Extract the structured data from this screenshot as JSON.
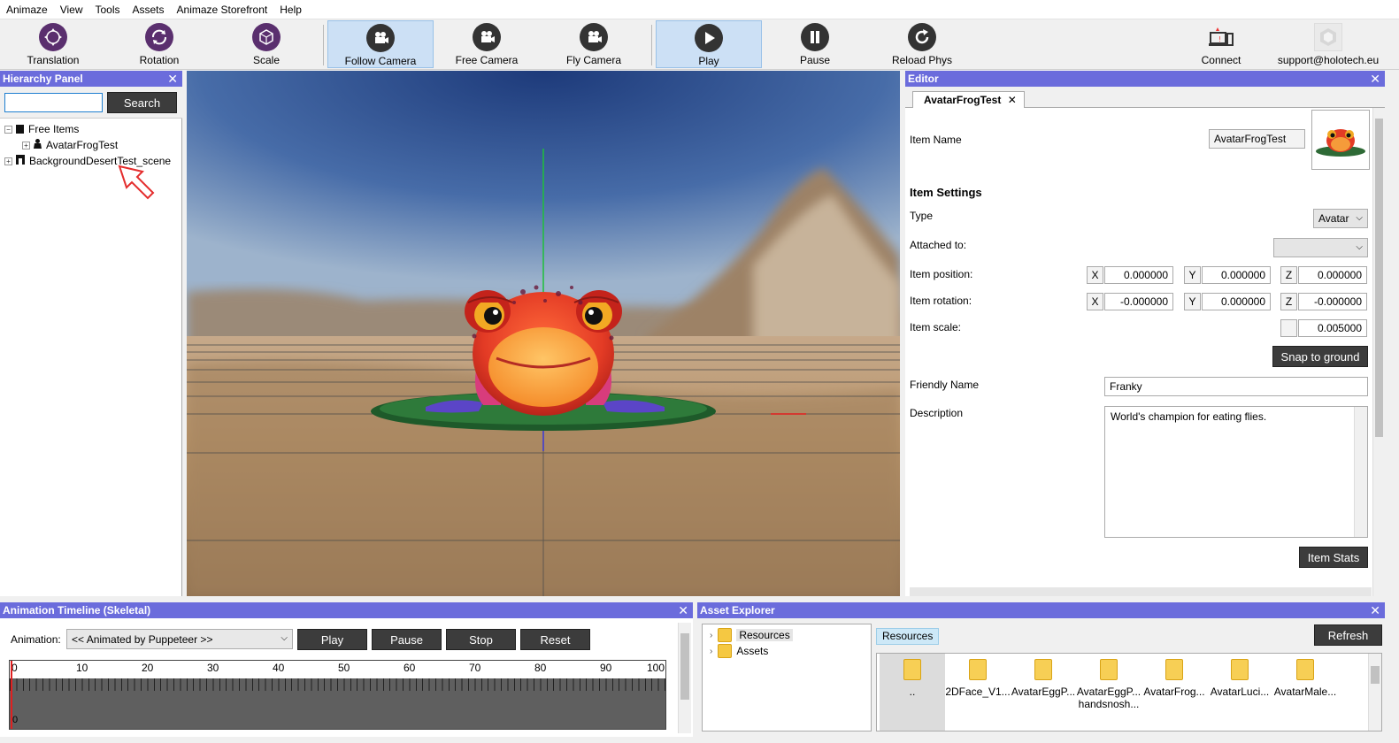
{
  "menu": [
    "Animaze",
    "View",
    "Tools",
    "Assets",
    "Animaze Storefront",
    "Help"
  ],
  "toolbar": {
    "translation": "Translation",
    "rotation": "Rotation",
    "scale": "Scale",
    "follow_camera": "Follow Camera",
    "free_camera": "Free Camera",
    "fly_camera": "Fly Camera",
    "play": "Play",
    "pause": "Pause",
    "reload_phys": "Reload Phys",
    "connect": "Connect",
    "support": "support@holotech.eu"
  },
  "hierarchy": {
    "title": "Hierarchy Panel",
    "search_value": "",
    "search_button": "Search",
    "items": [
      {
        "label": "Free Items"
      },
      {
        "label": "AvatarFrogTest"
      },
      {
        "label": "BackgroundDesertTest_scene"
      }
    ]
  },
  "editor": {
    "title": "Editor",
    "tab": "AvatarFrogTest",
    "item_name_label": "Item Name",
    "item_name_value": "AvatarFrogTest",
    "item_settings": "Item Settings",
    "type_label": "Type",
    "type_value": "Avatar",
    "attached_label": "Attached to:",
    "attached_value": "",
    "position_label": "Item position:",
    "position": {
      "x": "0.000000",
      "y": "0.000000",
      "z": "0.000000"
    },
    "rotation_label": "Item rotation:",
    "rotation": {
      "x": "-0.000000",
      "y": "0.000000",
      "z": "-0.000000"
    },
    "scale_label": "Item scale:",
    "scale_value": "0.005000",
    "snap_button": "Snap to ground",
    "friendly_label": "Friendly Name",
    "friendly_value": "Franky",
    "description_label": "Description",
    "description_value": "World's champion for eating flies.",
    "stats_button": "Item Stats",
    "axis": {
      "x": "X",
      "y": "Y",
      "z": "Z"
    }
  },
  "timeline": {
    "title": "Animation Timeline (Skeletal)",
    "animation_label": "Animation:",
    "animation_value": "<< Animated by Puppeteer >>",
    "buttons": {
      "play": "Play",
      "pause": "Pause",
      "stop": "Stop",
      "reset": "Reset"
    },
    "ticks": [
      "0",
      "10",
      "20",
      "30",
      "40",
      "50",
      "60",
      "70",
      "80",
      "90",
      "100"
    ],
    "cursor_value": "0"
  },
  "assets": {
    "title": "Asset Explorer",
    "tree": [
      {
        "label": "Resources"
      },
      {
        "label": "Assets"
      }
    ],
    "breadcrumb": "Resources",
    "refresh_button": "Refresh",
    "items": [
      {
        "name": ".."
      },
      {
        "name": "2DFace_V1..."
      },
      {
        "name": "AvatarEggP..."
      },
      {
        "name": "AvatarEggP...",
        "name2": "handsnosh..."
      },
      {
        "name": "AvatarFrog..."
      },
      {
        "name": "AvatarLuci..."
      },
      {
        "name": "AvatarMale..."
      }
    ]
  },
  "colors": {
    "panel_header": "#6b6cdc",
    "button_dark": "#3c3c3c",
    "accent_active": "#cce0f5",
    "frog": "#e8442a"
  }
}
